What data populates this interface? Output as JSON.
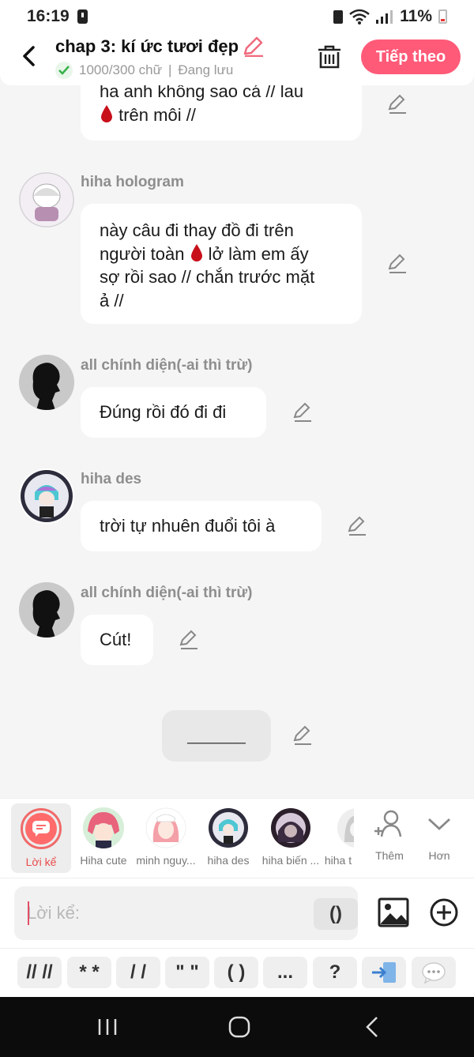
{
  "status": {
    "time": "16:19",
    "battery": "11%"
  },
  "header": {
    "title": "chap 3: kí ức tươi đẹp",
    "word_count": "1000/300 chữ",
    "save_status": "Đang lưu",
    "next_label": "Tiếp theo",
    "accent": "#ff5a78"
  },
  "messages": [
    {
      "lines": [
        "ha anh không sao cá // lau",
        "{drop} trên môi //"
      ]
    },
    {
      "sender": "hiha hologram",
      "lines": [
        "này câu đi thay đồ đi trên",
        "người toàn {drop} lở làm em ấy",
        "sợ rồi sao // chắn trước mặt",
        "ả //"
      ]
    },
    {
      "sender": "all chính diện(-ai thì trừ)",
      "lines": [
        "Đúng rồi đó đi đi"
      ]
    },
    {
      "sender": "hiha des",
      "lines": [
        "trời tự nhuên đuổi tôi à"
      ]
    },
    {
      "sender": "all chính diện(-ai thì trừ)",
      "lines": [
        "Cút!"
      ]
    },
    {
      "lines": [
        "______"
      ]
    }
  ],
  "characters": {
    "narrator": "Lời kể",
    "list": [
      "Hiha cute",
      "minh nguy...",
      "hiha des",
      "hiha biến ...",
      "hiha t"
    ],
    "add": "Thêm",
    "more": "Hơn"
  },
  "input": {
    "placeholder": "Lời kể:",
    "paren": "()"
  },
  "shortcuts": [
    "// //",
    "* *",
    "/ /",
    "\" \"",
    "( )",
    "...",
    "?"
  ],
  "icons": [
    "back-arrow-icon",
    "pencil-icon",
    "check-icon",
    "trash-icon",
    "drop-emoji-icon",
    "edit-icon",
    "narrator-icon",
    "add-person-icon",
    "chevron-down-icon",
    "image-icon",
    "plus-circle-icon",
    "insert-icon",
    "chat-bubble-icon",
    "recents-icon",
    "home-icon",
    "back-icon"
  ]
}
